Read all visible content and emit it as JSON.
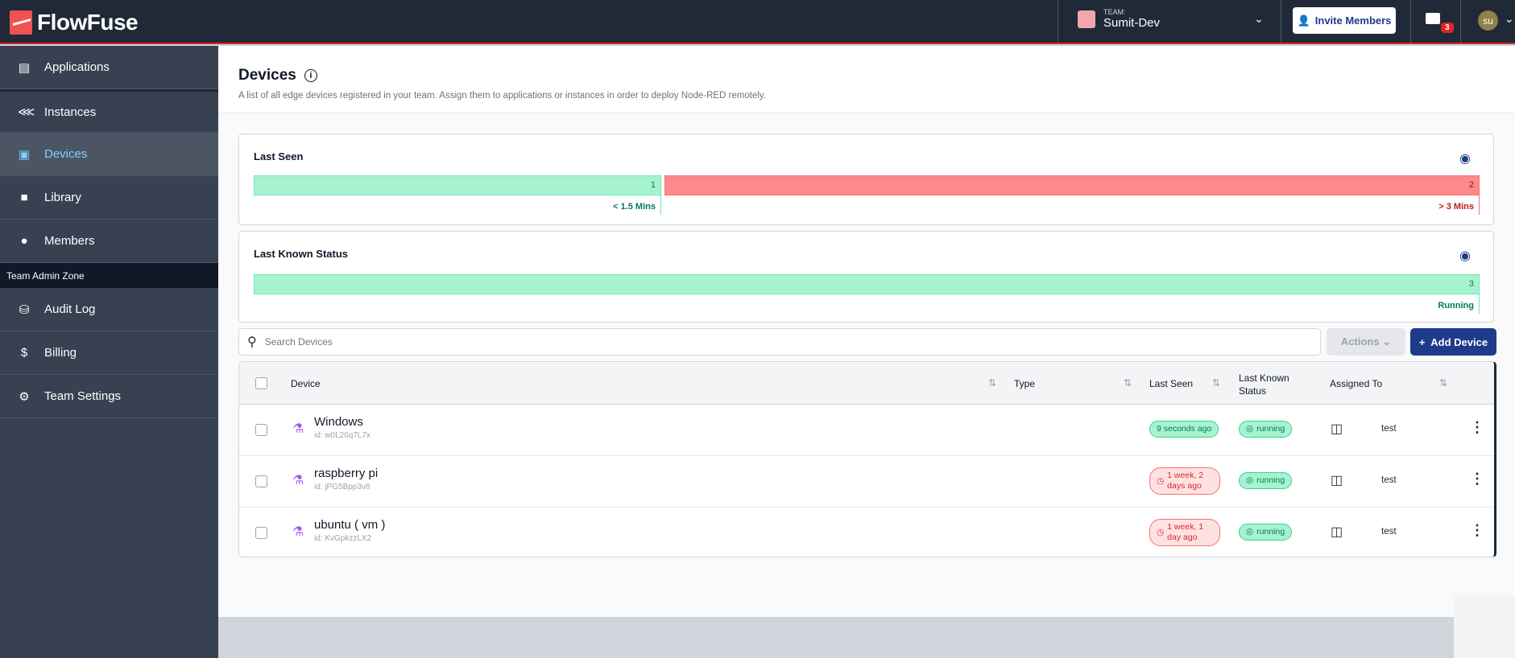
{
  "header": {
    "brand": "FlowFuse",
    "team_label": "TEAM:",
    "team_name": "Sumit-Dev",
    "invite_label": "Invite Members",
    "notifications_count": "3",
    "user_initials": "su"
  },
  "sidebar": {
    "items": [
      {
        "label": "Applications",
        "icon": "layout-icon"
      },
      {
        "label": "Instances",
        "icon": "instances-icon"
      },
      {
        "label": "Devices",
        "icon": "chip-icon",
        "active": true
      },
      {
        "label": "Library",
        "icon": "folder-icon"
      },
      {
        "label": "Members",
        "icon": "users-icon"
      }
    ],
    "zone_label": "Team Admin Zone",
    "admin_items": [
      {
        "label": "Audit Log",
        "icon": "database-icon"
      },
      {
        "label": "Billing",
        "icon": "dollar-icon"
      },
      {
        "label": "Team Settings",
        "icon": "gear-icon"
      }
    ]
  },
  "page": {
    "title": "Devices",
    "description": "A list of all edge devices registered in your team. Assign them to applications or instances in order to deploy Node-RED remotely."
  },
  "last_seen": {
    "title": "Last Seen",
    "segments": [
      {
        "count": "1",
        "label": "< 1.5 Mins",
        "color": "#a7f3d0"
      },
      {
        "count": "2",
        "label": "> 3 Mins",
        "color": "#fc8a8a"
      }
    ]
  },
  "last_status": {
    "title": "Last Known Status",
    "segments": [
      {
        "count": "3",
        "label": "Running",
        "color": "#a7f3d0"
      }
    ]
  },
  "toolbar": {
    "search_placeholder": "Search Devices",
    "actions_label": "Actions",
    "add_label": "Add Device"
  },
  "table": {
    "columns": [
      "Device",
      "Type",
      "Last Seen",
      "Last Known Status",
      "Assigned To"
    ],
    "rows": [
      {
        "name": "Windows",
        "id": "id: w0L26q7L7x",
        "last_seen": "9 seconds ago",
        "last_seen_state": "ok",
        "status": "running",
        "assigned": "test"
      },
      {
        "name": "raspberry pi",
        "id": "id: jPG5Bpp3v8",
        "last_seen": "1 week, 2 days ago",
        "last_seen_state": "stale",
        "status": "running",
        "assigned": "test"
      },
      {
        "name": "ubuntu ( vm )",
        "id": "id: KvGpkzzLX2",
        "last_seen": "1 week, 1 day ago",
        "last_seen_state": "stale",
        "status": "running",
        "assigned": "test"
      }
    ]
  }
}
